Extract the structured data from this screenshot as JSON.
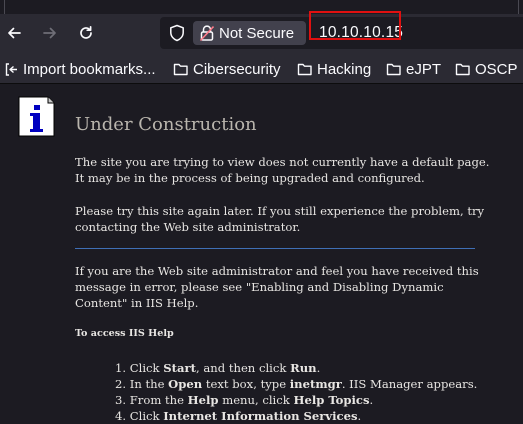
{
  "browser": {
    "security_label": "Not Secure",
    "url": "10.10.10.15",
    "bookmarks": [
      {
        "label": "Import bookmarks...",
        "icon": "import-icon"
      },
      {
        "label": "Cibersecurity",
        "icon": "folder-icon"
      },
      {
        "label": "Hacking",
        "icon": "folder-icon"
      },
      {
        "label": "eJPT",
        "icon": "folder-icon"
      },
      {
        "label": "OSCP",
        "icon": "folder-icon"
      }
    ],
    "accent_color": "#e01010"
  },
  "page": {
    "title": "Under Construction",
    "para1_line1": "The site you are trying to view does not currently have a default page.",
    "para1_line2": "It may be in the process of being upgraded and configured.",
    "para2_line1": "Please try this site again later. If you still experience the problem, try",
    "para2_line2": "contacting the Web site administrator.",
    "para3_line1": "If you are the Web site administrator and feel you have received this",
    "para3_line2": "message in error, please see \"Enabling and Disabling Dynamic",
    "para3_line3": "Content\" in IIS Help.",
    "help_heading": "To access IIS Help",
    "steps": [
      {
        "n": "1.",
        "a": "Click ",
        "b1": "Start",
        "c": ", and then click ",
        "b2": "Run",
        "d": "."
      },
      {
        "n": "2.",
        "a": "In the ",
        "b1": "Open",
        "c": " text box, type ",
        "b2": "inetmgr",
        "d": ". IIS Manager appears."
      },
      {
        "n": "3.",
        "a": "From the ",
        "b1": "Help",
        "c": " menu, click ",
        "b2": "Help Topics",
        "d": "."
      },
      {
        "n": "4.",
        "a": "Click ",
        "b1": "Internet Information Services",
        "c": "",
        "b2": "",
        "d": "."
      }
    ]
  }
}
